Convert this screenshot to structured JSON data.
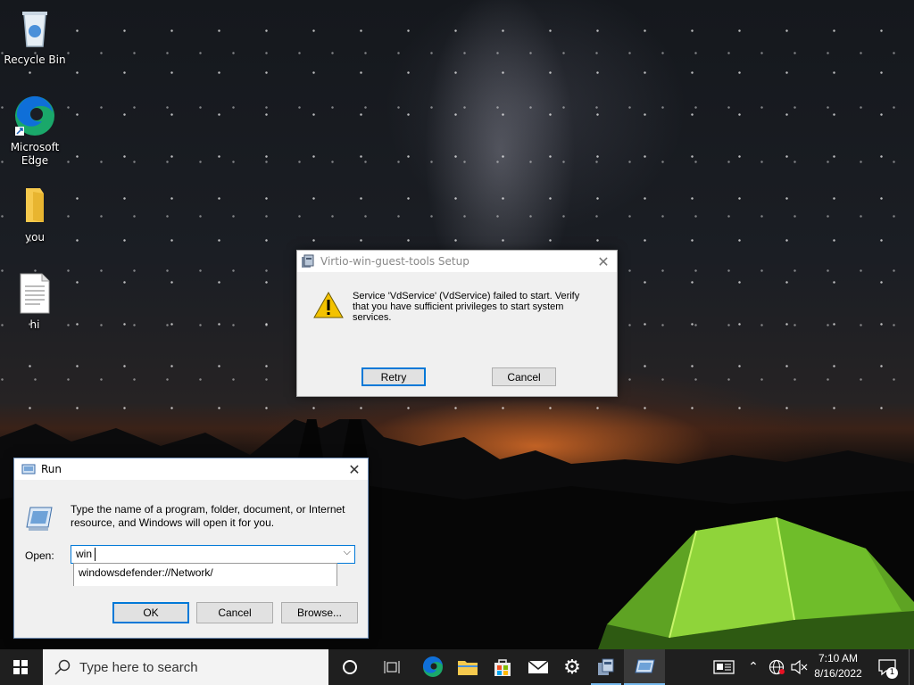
{
  "desktop_icons": [
    {
      "label": "Recycle Bin",
      "icon": "recycle-bin-icon"
    },
    {
      "label": "Microsoft Edge",
      "icon": "edge-icon"
    },
    {
      "label": "you",
      "icon": "folder-icon"
    },
    {
      "label": "hi",
      "icon": "text-file-icon"
    }
  ],
  "setup_dialog": {
    "title": "Virtio-win-guest-tools Setup",
    "message": "Service 'VdService' (VdService) failed to start.  Verify that you have sufficient privileges to start system services.",
    "retry_label": "Retry",
    "cancel_label": "Cancel",
    "icon": "warning-icon"
  },
  "run_dialog": {
    "title": "Run",
    "description": "Type the name of a program, folder, document, or Internet resource, and Windows will open it for you.",
    "open_label": "Open:",
    "input_value": "win",
    "suggestion": "windowsdefender://Network/",
    "ok_label": "OK",
    "cancel_label": "Cancel",
    "browse_label": "Browse..."
  },
  "taskbar": {
    "search_placeholder": "Type here to search",
    "time": "7:10 AM",
    "date": "8/16/2022",
    "notification_count": "1",
    "accent": "#0078d7"
  }
}
